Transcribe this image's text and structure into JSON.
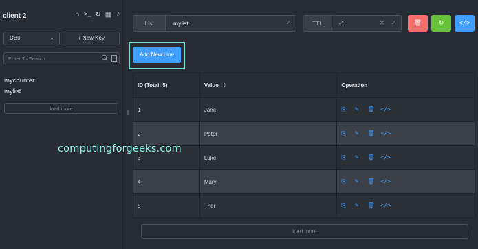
{
  "sidebar": {
    "connection_name": "client 2",
    "icons": [
      "home-icon",
      "terminal-icon",
      "refresh-icon",
      "grid-icon",
      "chevron-up-icon"
    ],
    "db_select": {
      "value": "DB0"
    },
    "new_key_label": "+ New Key",
    "search": {
      "placeholder": "Enter To Search"
    },
    "keys": [
      "mycounter",
      "mylist"
    ],
    "load_more_label": "load more"
  },
  "key_header": {
    "type_label": "List",
    "key_name": "mylist",
    "ttl_label": "TTL",
    "ttl_value": "-1",
    "actions": [
      {
        "name": "delete-button",
        "icon": "trash-icon",
        "color": "#f56c6c"
      },
      {
        "name": "refresh-button",
        "icon": "refresh-icon",
        "color": "#67c23a"
      },
      {
        "name": "code-button",
        "icon": "code-icon",
        "color": "#409eff"
      }
    ]
  },
  "add_new_line_label": "Add New Line",
  "table": {
    "columns": [
      "ID (Total: 5)",
      "Value",
      "Operation"
    ],
    "rows": [
      {
        "id": "1",
        "value": "Jane"
      },
      {
        "id": "2",
        "value": "Peter"
      },
      {
        "id": "3",
        "value": "Luke"
      },
      {
        "id": "4",
        "value": "Mary"
      },
      {
        "id": "5",
        "value": "Thor"
      }
    ],
    "operation_icons": [
      "copy-icon",
      "edit-icon",
      "delete-icon",
      "code-icon"
    ]
  },
  "main_load_more_label": "load more",
  "watermark": "computingforgeeks.com",
  "colors": {
    "accent": "#409eff",
    "danger": "#f56c6c",
    "success": "#67c23a",
    "highlight": "#6fe2cf"
  }
}
